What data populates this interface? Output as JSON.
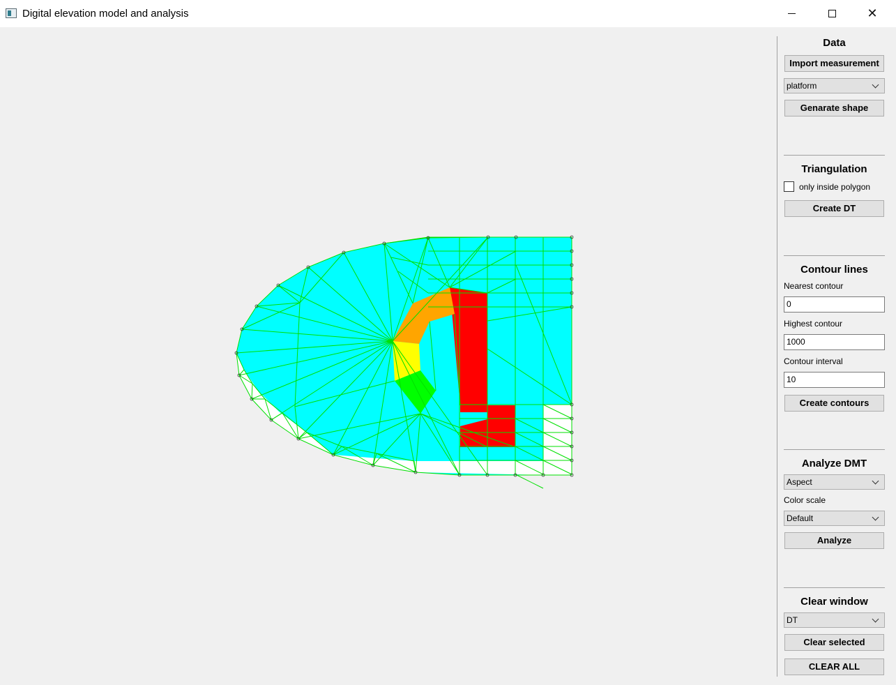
{
  "window": {
    "title": "Digital elevation model and analysis"
  },
  "colors": {
    "cyan": "#00ffff",
    "red": "#ff0000",
    "orange": "#ffa500",
    "yellow": "#ffff00",
    "green": "#00ff00",
    "edge": "#00e000"
  },
  "panel": {
    "data": {
      "title": "Data",
      "import_label": "Import measurement",
      "shape_combo": "platform",
      "generate_label": "Genarate shape"
    },
    "triangulation": {
      "title": "Triangulation",
      "checkbox_label": "only inside polygon",
      "checkbox_checked": false,
      "create_label": "Create DT"
    },
    "contours": {
      "title": "Contour lines",
      "nearest_label": "Nearest contour",
      "nearest_value": "0",
      "highest_label": "Highest contour",
      "highest_value": "1000",
      "interval_label": "Contour interval",
      "interval_value": "10",
      "create_label": "Create contours"
    },
    "analyze": {
      "title": "Analyze DMT",
      "mode_combo": "Aspect",
      "scale_label": "Color scale",
      "scale_combo": "Default",
      "analyze_label": "Analyze"
    },
    "clear": {
      "title": "Clear window",
      "target_combo": "DT",
      "clear_selected_label": "Clear selected",
      "clear_all_label": "CLEAR ALL"
    }
  }
}
